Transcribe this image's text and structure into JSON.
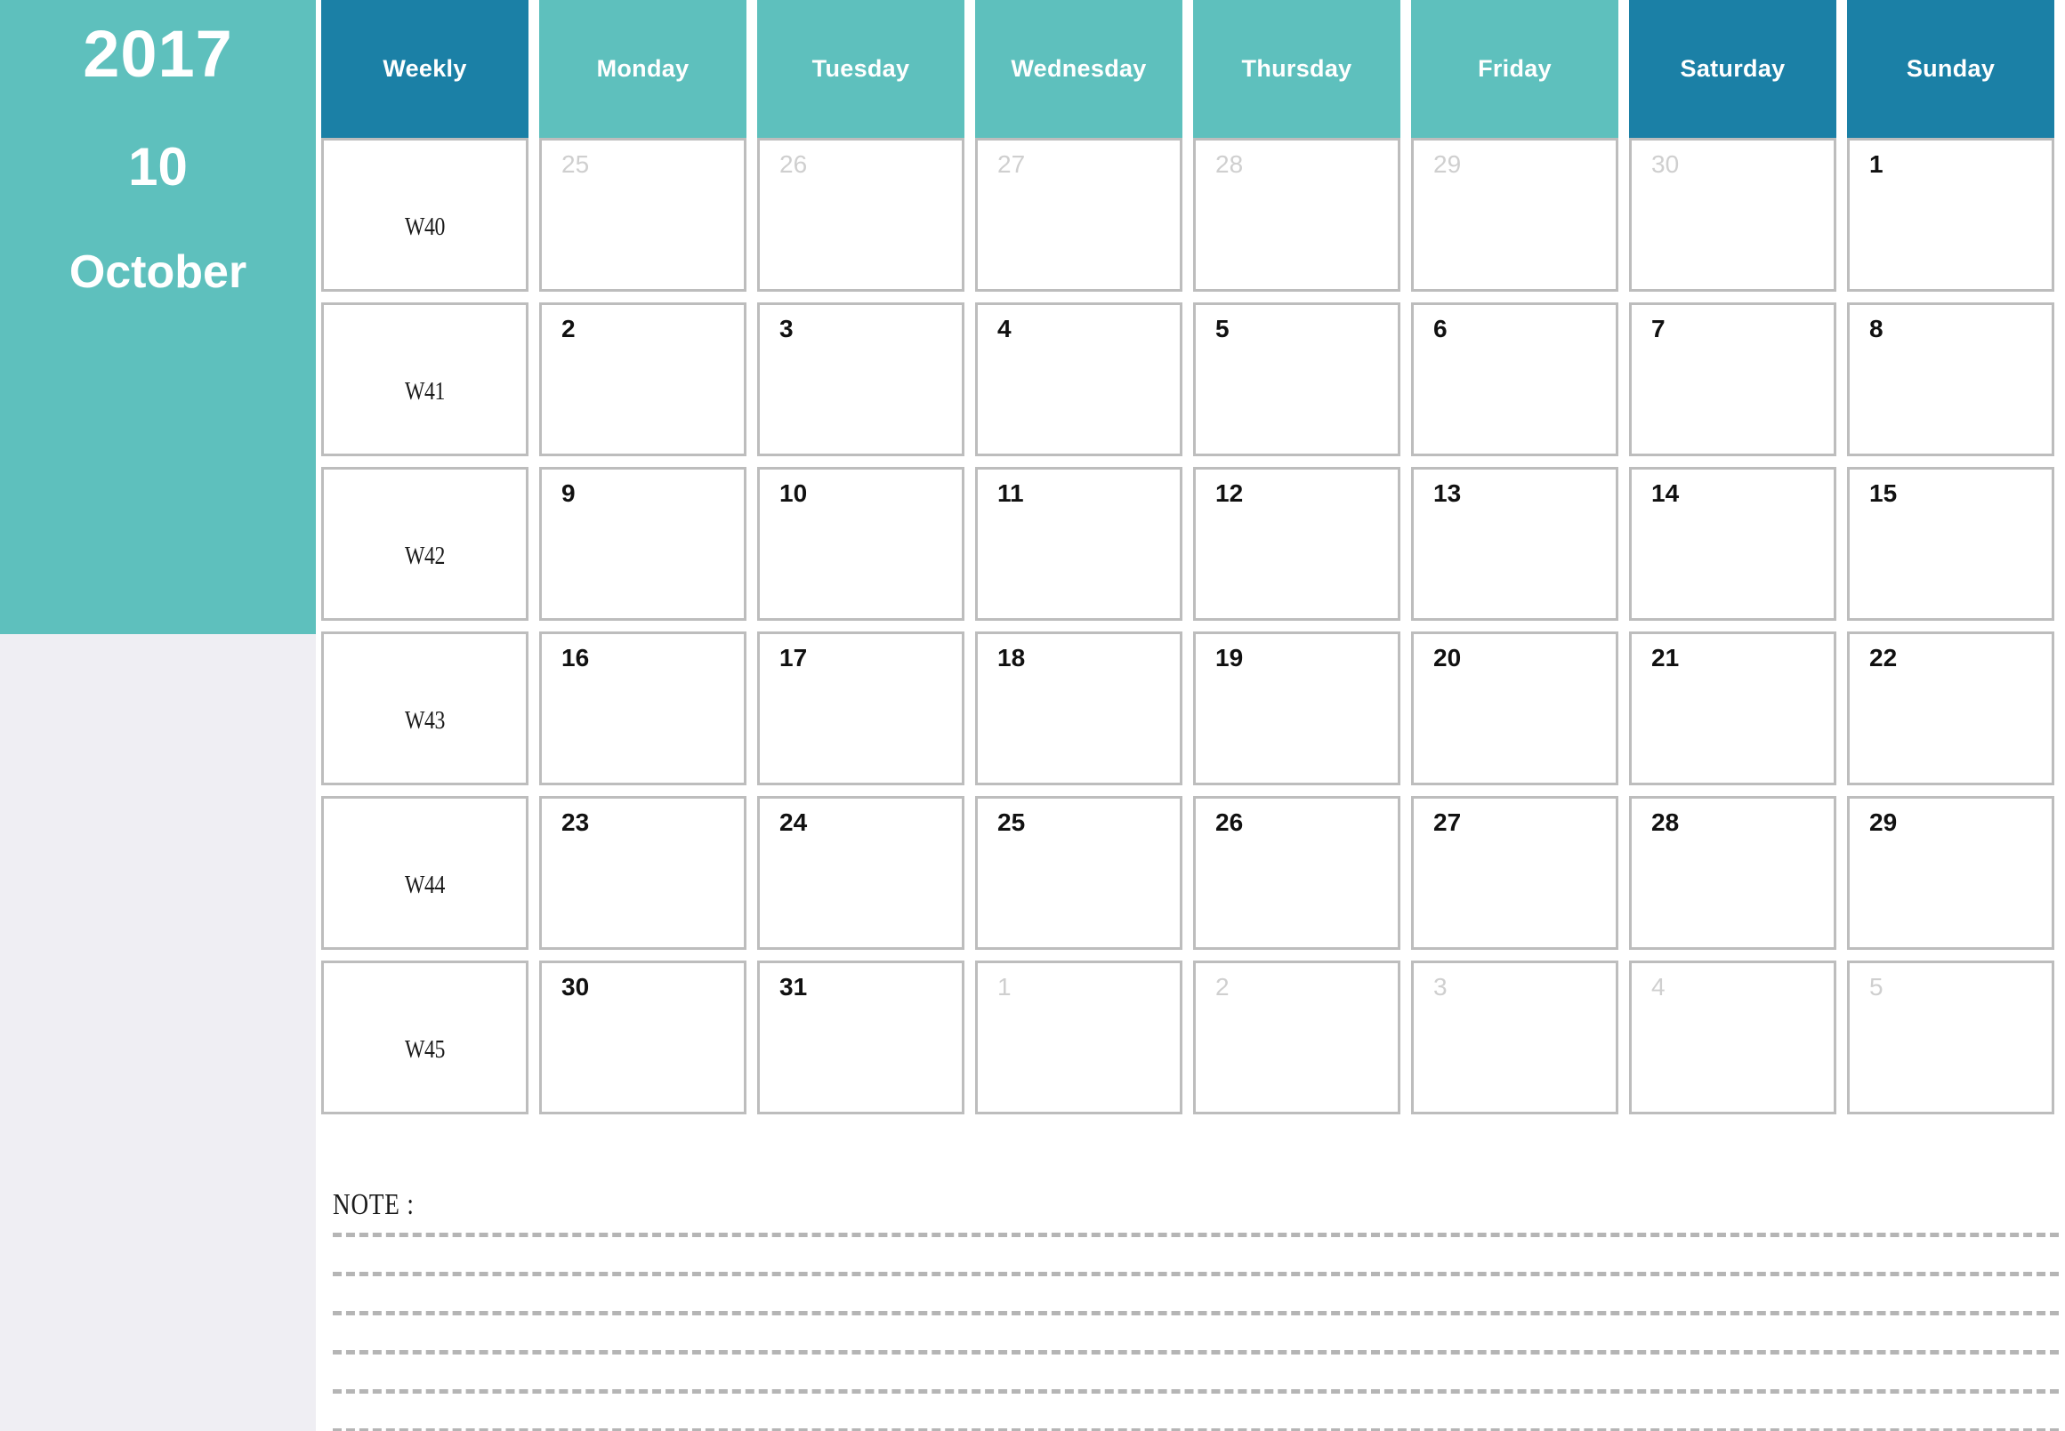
{
  "sidebar": {
    "year": "2017",
    "month_number": "10",
    "month_name": "October"
  },
  "calendar": {
    "columns": [
      {
        "key": "weekly",
        "label": "Weekly",
        "style": "weeklbl"
      },
      {
        "key": "monday",
        "label": "Monday",
        "style": "weekday"
      },
      {
        "key": "tuesday",
        "label": "Tuesday",
        "style": "weekday"
      },
      {
        "key": "wednesday",
        "label": "Wednesday",
        "style": "weekday"
      },
      {
        "key": "thursday",
        "label": "Thursday",
        "style": "weekday"
      },
      {
        "key": "friday",
        "label": "Friday",
        "style": "weekday"
      },
      {
        "key": "saturday",
        "label": "Saturday",
        "style": "weekend"
      },
      {
        "key": "sunday",
        "label": "Sunday",
        "style": "weekend"
      }
    ],
    "rows": [
      {
        "week": "W40",
        "days": [
          {
            "n": "25",
            "muted": true
          },
          {
            "n": "26",
            "muted": true
          },
          {
            "n": "27",
            "muted": true
          },
          {
            "n": "28",
            "muted": true
          },
          {
            "n": "29",
            "muted": true
          },
          {
            "n": "30",
            "muted": true
          },
          {
            "n": "1",
            "muted": false
          }
        ]
      },
      {
        "week": "W41",
        "days": [
          {
            "n": "2",
            "muted": false
          },
          {
            "n": "3",
            "muted": false
          },
          {
            "n": "4",
            "muted": false
          },
          {
            "n": "5",
            "muted": false
          },
          {
            "n": "6",
            "muted": false
          },
          {
            "n": "7",
            "muted": false
          },
          {
            "n": "8",
            "muted": false
          }
        ]
      },
      {
        "week": "W42",
        "days": [
          {
            "n": "9",
            "muted": false
          },
          {
            "n": "10",
            "muted": false
          },
          {
            "n": "11",
            "muted": false
          },
          {
            "n": "12",
            "muted": false
          },
          {
            "n": "13",
            "muted": false
          },
          {
            "n": "14",
            "muted": false
          },
          {
            "n": "15",
            "muted": false
          }
        ]
      },
      {
        "week": "W43",
        "days": [
          {
            "n": "16",
            "muted": false
          },
          {
            "n": "17",
            "muted": false
          },
          {
            "n": "18",
            "muted": false
          },
          {
            "n": "19",
            "muted": false
          },
          {
            "n": "20",
            "muted": false
          },
          {
            "n": "21",
            "muted": false
          },
          {
            "n": "22",
            "muted": false
          }
        ]
      },
      {
        "week": "W44",
        "days": [
          {
            "n": "23",
            "muted": false
          },
          {
            "n": "24",
            "muted": false
          },
          {
            "n": "25",
            "muted": false
          },
          {
            "n": "26",
            "muted": false
          },
          {
            "n": "27",
            "muted": false
          },
          {
            "n": "28",
            "muted": false
          },
          {
            "n": "29",
            "muted": false
          }
        ]
      },
      {
        "week": "W45",
        "days": [
          {
            "n": "30",
            "muted": false
          },
          {
            "n": "31",
            "muted": false
          },
          {
            "n": "1",
            "muted": true
          },
          {
            "n": "2",
            "muted": true
          },
          {
            "n": "3",
            "muted": true
          },
          {
            "n": "4",
            "muted": true
          },
          {
            "n": "5",
            "muted": true
          }
        ]
      }
    ]
  },
  "note": {
    "label": "NOTE :",
    "line_count": 6
  },
  "colors": {
    "sidebar_teal": "#5ec0bd",
    "header_weekday": "#5ec0bd",
    "header_weekend": "#1b80a6",
    "sidebar_lower_gray": "#efeef3",
    "cell_border": "#bdbdbd",
    "muted_date": "#cfcfcf",
    "active_date": "#111111",
    "note_rule": "#b5b5b5"
  }
}
